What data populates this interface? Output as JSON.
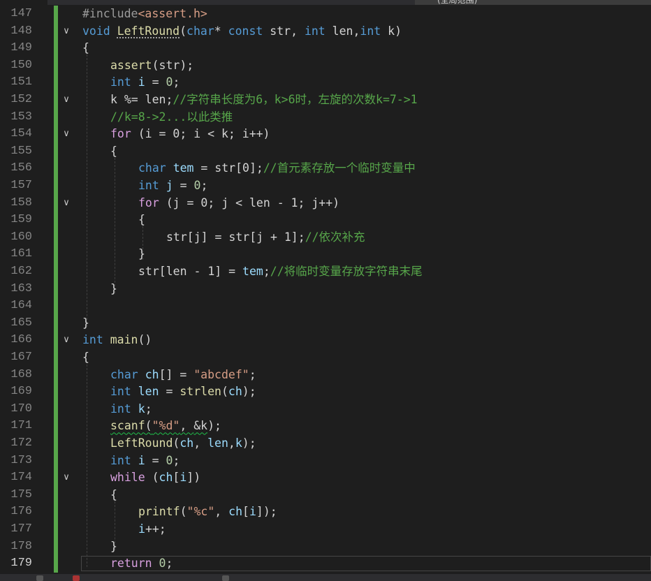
{
  "window": {
    "top_label": "(全局范围)"
  },
  "editor": {
    "current_line": "179",
    "lines": [
      {
        "no": "147",
        "fold": ""
      },
      {
        "no": "148",
        "fold": "collapse"
      },
      {
        "no": "149",
        "fold": ""
      },
      {
        "no": "150",
        "fold": ""
      },
      {
        "no": "151",
        "fold": ""
      },
      {
        "no": "152",
        "fold": "collapse"
      },
      {
        "no": "153",
        "fold": ""
      },
      {
        "no": "154",
        "fold": "collapse"
      },
      {
        "no": "155",
        "fold": ""
      },
      {
        "no": "156",
        "fold": ""
      },
      {
        "no": "157",
        "fold": ""
      },
      {
        "no": "158",
        "fold": "collapse"
      },
      {
        "no": "159",
        "fold": ""
      },
      {
        "no": "160",
        "fold": ""
      },
      {
        "no": "161",
        "fold": ""
      },
      {
        "no": "162",
        "fold": ""
      },
      {
        "no": "163",
        "fold": ""
      },
      {
        "no": "164",
        "fold": ""
      },
      {
        "no": "165",
        "fold": ""
      },
      {
        "no": "166",
        "fold": "collapse"
      },
      {
        "no": "167",
        "fold": ""
      },
      {
        "no": "168",
        "fold": ""
      },
      {
        "no": "169",
        "fold": ""
      },
      {
        "no": "170",
        "fold": ""
      },
      {
        "no": "171",
        "fold": ""
      },
      {
        "no": "172",
        "fold": ""
      },
      {
        "no": "173",
        "fold": ""
      },
      {
        "no": "174",
        "fold": "collapse"
      },
      {
        "no": "175",
        "fold": ""
      },
      {
        "no": "176",
        "fold": ""
      },
      {
        "no": "177",
        "fold": ""
      },
      {
        "no": "178",
        "fold": ""
      },
      {
        "no": "179",
        "fold": ""
      }
    ],
    "tokens": {
      "l147": [
        "#include",
        "<assert.h>"
      ],
      "l148": [
        "void",
        " ",
        "LeftRound",
        "(",
        "char",
        "* ",
        "const",
        " str, ",
        "int",
        " len,",
        "int",
        " k)"
      ],
      "l149": [
        "{"
      ],
      "l150": [
        "assert",
        "(str);"
      ],
      "l151": [
        "int",
        " ",
        "i",
        " = ",
        "0",
        ";"
      ],
      "l152": [
        "k %= len;",
        "//字符串长度为6，k>6时，左旋的次数k=7->1"
      ],
      "l153": [
        "//k=8->2...以此类推"
      ],
      "l154": [
        "for",
        " (i = 0; i < k; i++)"
      ],
      "l155": [
        "{"
      ],
      "l156": [
        "char",
        " ",
        "tem",
        " = str[0];",
        "//首元素存放一个临时变量中"
      ],
      "l157": [
        "int",
        " ",
        "j",
        " = ",
        "0",
        ";"
      ],
      "l158": [
        "for",
        " (j = 0; j < len - 1; j++)"
      ],
      "l159": [
        "{"
      ],
      "l160": [
        "str[j] = str[j + 1];",
        "//依次补充"
      ],
      "l161": [
        "}"
      ],
      "l162": [
        "str[len - 1] = ",
        "tem",
        ";",
        "//将临时变量存放字符串末尾"
      ],
      "l163": [
        "}"
      ],
      "l164": [
        ""
      ],
      "l165": [
        "}"
      ],
      "l166": [
        "int",
        " ",
        "main",
        "()"
      ],
      "l167": [
        "{"
      ],
      "l168": [
        "char",
        " ",
        "ch",
        "[] = ",
        "\"abcdef\"",
        ";"
      ],
      "l169": [
        "int",
        " ",
        "len",
        " = ",
        "strlen",
        "(",
        "ch",
        ");"
      ],
      "l170": [
        "int",
        " ",
        "k",
        ";"
      ],
      "l171": [
        "scanf",
        "(",
        "\"%d\"",
        ", ",
        "&k",
        ");"
      ],
      "l172": [
        "LeftRound",
        "(",
        "ch",
        ", ",
        "len",
        ",",
        "k",
        ");"
      ],
      "l173": [
        "int",
        " ",
        "i",
        " = ",
        "0",
        ";"
      ],
      "l174": [
        "while",
        " (",
        "ch",
        "[",
        "i",
        "])"
      ],
      "l175": [
        "{"
      ],
      "l176": [
        "printf",
        "(",
        "\"%c\"",
        ", ",
        "ch",
        "[",
        "i",
        "]);"
      ],
      "l177": [
        "i",
        "++;"
      ],
      "l178": [
        "}"
      ],
      "l179": [
        "return",
        " ",
        "0",
        ";"
      ]
    }
  },
  "colors": {
    "background": "#1e1e1e",
    "keyword": "#569cd6",
    "control": "#d8a0df",
    "function": "#dcdcaa",
    "string": "#d69d85",
    "number": "#b5cea8",
    "comment": "#57a64a",
    "variable": "#9cdcfe",
    "changebar": "#57a64a"
  }
}
